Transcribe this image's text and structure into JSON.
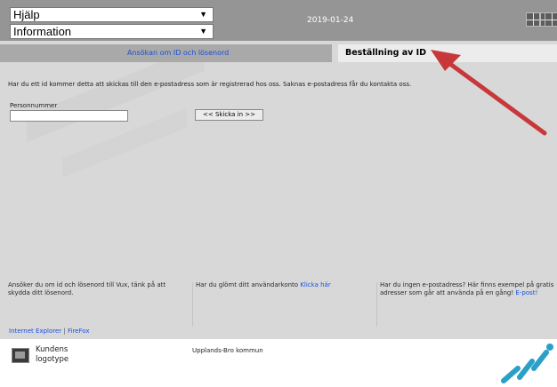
{
  "header": {
    "help_select": "Hjälp",
    "info_select": "Information",
    "date": "2019-01-24"
  },
  "tabs": [
    {
      "label": "Ansökan om ID och lösenord"
    },
    {
      "label": "Beställning av ID"
    }
  ],
  "main": {
    "info_text": "Har du ett id kommer detta att skickas till den e-postadress som är registrerad hos oss. Saknas e-postadress får du kontakta oss.",
    "person_label": "Personnummer",
    "person_value": "",
    "submit_label": "<< Skicka in >>"
  },
  "footer": {
    "col1": "Ansöker du om id och lösenord till Vux, tänk på att skydda ditt lösenord.",
    "col2_text": "Har du glömt ditt användarkonto",
    "col2_link": "Klicka här",
    "col3_text": "Har du ingen e-postadress? Här finns exempel på gratis adresser som går att använda på en gång!",
    "col3_link": "E-post!",
    "browser_ie": "Internet Explorer",
    "browser_sep": "|",
    "browser_ff": "FireFox"
  },
  "bottom": {
    "logo_line1": "Kundens",
    "logo_line2": "logotype",
    "municipality": "Upplands-Bro kommun"
  },
  "colors": {
    "link": "#1a4fe0",
    "arrow": "#c8383a"
  }
}
